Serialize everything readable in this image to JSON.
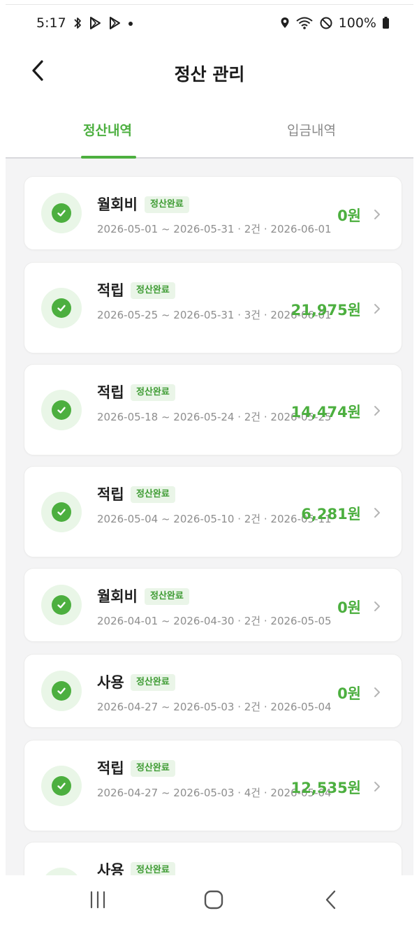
{
  "status_bar": {
    "time": "5:17",
    "battery": "100%"
  },
  "header": {
    "title": "정산 관리"
  },
  "tabs": [
    {
      "label": "정산내역",
      "active": true
    },
    {
      "label": "입금내역",
      "active": false
    }
  ],
  "items": [
    {
      "title": "월회비",
      "badge": "정산완료",
      "meta": "2026-05-01 ~ 2026-05-31 · 2건 · 2026-06-01",
      "amount": "0원"
    },
    {
      "title": "적립",
      "badge": "정산완료",
      "meta": "2026-05-25 ~ 2026-05-31 · 3건 · 2026-06-01",
      "amount": "21,975원"
    },
    {
      "title": "적립",
      "badge": "정산완료",
      "meta": "2026-05-18 ~ 2026-05-24 · 2건 · 2026-05-25",
      "amount": "14,474원"
    },
    {
      "title": "적립",
      "badge": "정산완료",
      "meta": "2026-05-04 ~ 2026-05-10 · 2건 · 2026-05-11",
      "amount": "6,281원"
    },
    {
      "title": "월회비",
      "badge": "정산완료",
      "meta": "2026-04-01 ~ 2026-04-30 · 2건 · 2026-05-05",
      "amount": "0원"
    },
    {
      "title": "사용",
      "badge": "정산완료",
      "meta": "2026-04-27 ~ 2026-05-03 · 2건 · 2026-05-04",
      "amount": "0원"
    },
    {
      "title": "적립",
      "badge": "정산완료",
      "meta": "2026-04-27 ~ 2026-05-03 · 4건 · 2026-05-04",
      "amount": "12,535원"
    },
    {
      "title": "사용",
      "badge": "정산완료",
      "meta": "",
      "amount": ""
    }
  ],
  "colors": {
    "accent": "#4caf3f",
    "badge_bg": "#eaf5e8",
    "meta_text": "#8e8e8e"
  },
  "icons": {
    "back": "chevron-left-icon",
    "item_status": "check-circle-icon",
    "row_arrow": "chevron-right-icon"
  }
}
